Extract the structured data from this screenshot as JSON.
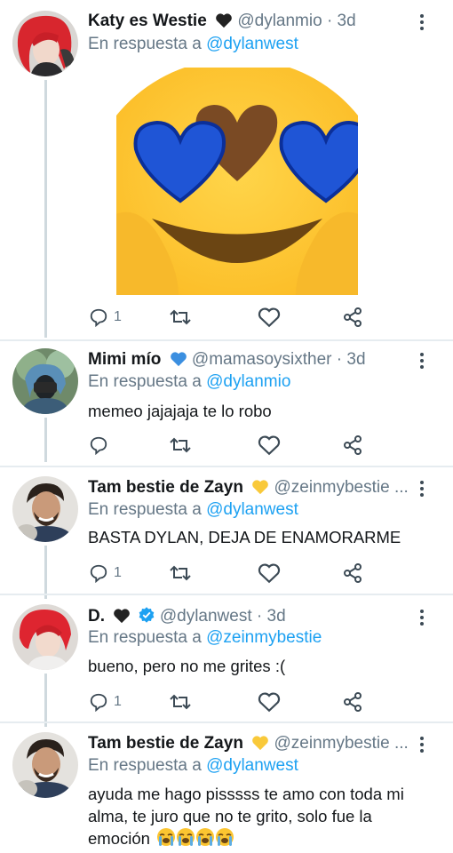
{
  "tweets": [
    {
      "name": "Katy es Westie",
      "name_badge": "black-heart",
      "handle": "@dylanmio · 3d",
      "reply_prefix": "En respuesta a",
      "reply_to": "@dylanwest",
      "text": "",
      "media": "emoji-heart-eyes-image",
      "reply_count": "1",
      "retweet_count": "",
      "like_count": ""
    },
    {
      "name": "Mimi mío",
      "name_badge": "blue-heart",
      "handle": "@mamasoysixther · 3d",
      "reply_prefix": "En respuesta a",
      "reply_to": "@dylanmio",
      "text": "memeo jajajaja te lo robo",
      "reply_count": "",
      "retweet_count": "",
      "like_count": ""
    },
    {
      "name": "Tam bestie de Zayn",
      "name_badge": "yellow-heart",
      "handle": "@zeinmybestie ...",
      "reply_prefix": "En respuesta a",
      "reply_to": "@dylanwest",
      "text": "BASTA DYLAN, DEJA DE ENAMORARME",
      "reply_count": "1",
      "retweet_count": "",
      "like_count": ""
    },
    {
      "name": "D.",
      "name_badge": "black-heart, verified",
      "handle": "@dylanwest · 3d",
      "reply_prefix": "En respuesta a",
      "reply_to": "@zeinmybestie",
      "text": "bueno, pero no me grites :(",
      "reply_count": "1",
      "retweet_count": "",
      "like_count": ""
    },
    {
      "name": "Tam bestie de Zayn",
      "name_badge": "yellow-heart",
      "handle": "@zeinmybestie ...",
      "reply_prefix": "En respuesta a",
      "reply_to": "@dylanwest",
      "text": "ayuda me hago pisssss te amo con toda mi alma, te juro que no te grito, solo fue la emoción",
      "text_emoji": "loudly-crying-face x4"
    }
  ],
  "colors": {
    "link": "#1da1f2",
    "muted": "#657786",
    "text": "#14171a",
    "verified": "#1da1f2",
    "divider": "#e6ecf0"
  }
}
